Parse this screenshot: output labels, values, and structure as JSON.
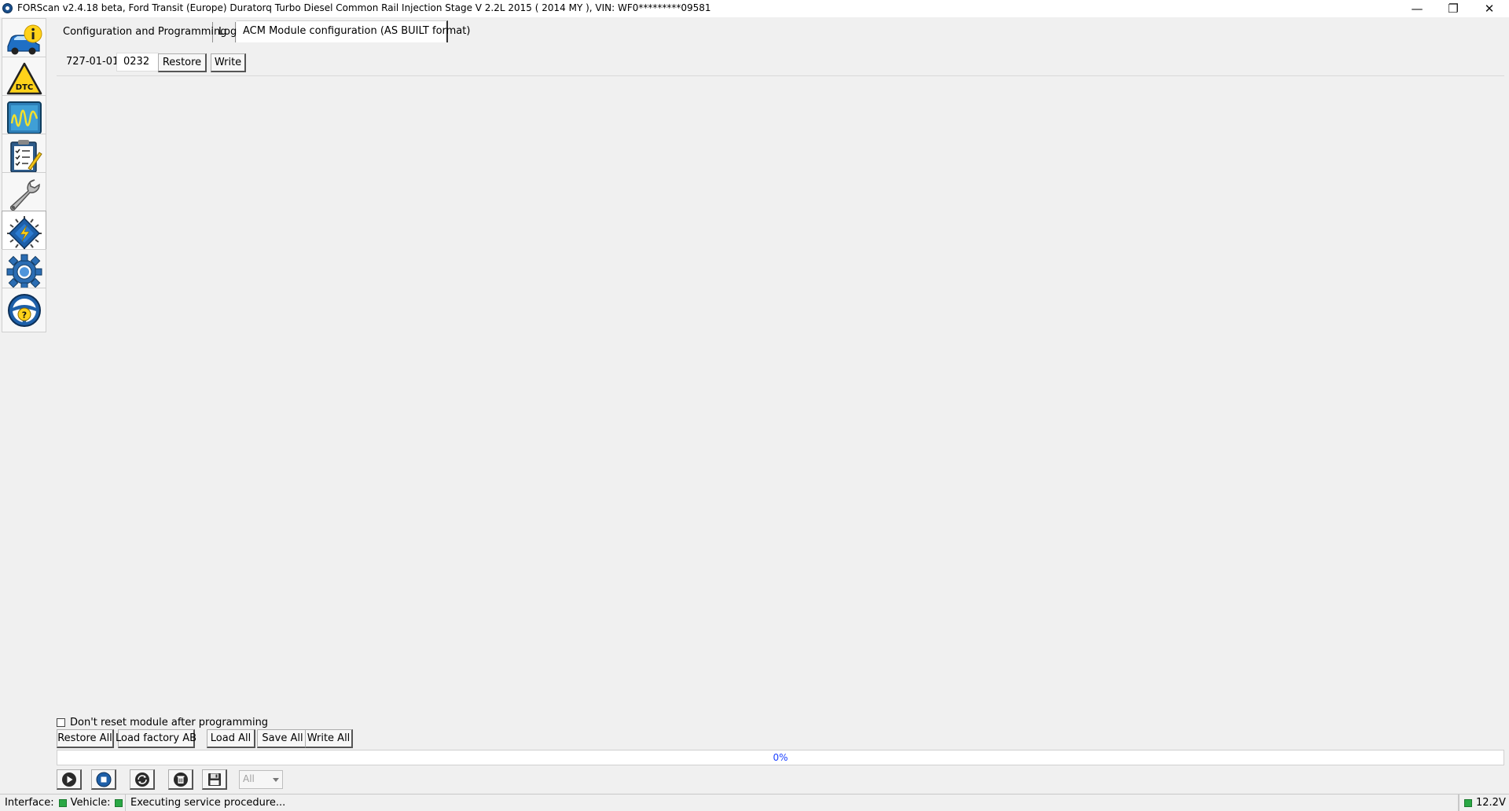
{
  "window": {
    "title": "FORScan v2.4.18 beta, Ford Transit (Europe) Duratorq Turbo Diesel Common Rail Injection Stage V 2.2L 2015 ( 2014 MY ), VIN: WF0*********09581",
    "minimize_glyph": "—",
    "restore_glyph": "❐",
    "close_glyph": "✕"
  },
  "sidebar": {
    "items": [
      {
        "name": "vehicle-info",
        "icon": "car-info-icon",
        "active": false
      },
      {
        "name": "dtc",
        "icon": "dtc-warning-icon",
        "active": false
      },
      {
        "name": "oscilloscope",
        "icon": "waveform-icon",
        "active": false
      },
      {
        "name": "tests",
        "icon": "checklist-icon",
        "active": false
      },
      {
        "name": "service",
        "icon": "wrench-icon",
        "active": false
      },
      {
        "name": "configuration",
        "icon": "chip-icon",
        "active": true
      },
      {
        "name": "settings",
        "icon": "gear-icon",
        "active": false
      },
      {
        "name": "help",
        "icon": "help-wheel-icon",
        "active": false
      }
    ],
    "dtc_label": "DTC",
    "help_label": "?"
  },
  "tabs": [
    {
      "label": "Configuration and Programming"
    },
    {
      "label": "Log"
    },
    {
      "label": "ACM Module configuration (AS BUILT format)"
    }
  ],
  "module": {
    "address": "727-01-01",
    "value": "0232",
    "restore_label": "Restore",
    "write_label": "Write"
  },
  "options": {
    "reset_label": "Don't reset module after programming",
    "reset_checked": false
  },
  "actions": {
    "restore_all": "Restore All",
    "load_factory": "Load factory AB",
    "load_all": "Load All",
    "save_all": "Save All",
    "write_all": "Write All"
  },
  "progress": {
    "percent": 0,
    "text": "0%"
  },
  "toolbar": {
    "filter_value": "All"
  },
  "status": {
    "interface_label": "Interface:",
    "vehicle_label": "Vehicle:",
    "message": "Executing service procedure...",
    "voltage": "12.2V",
    "led_color": "#2aa845"
  }
}
